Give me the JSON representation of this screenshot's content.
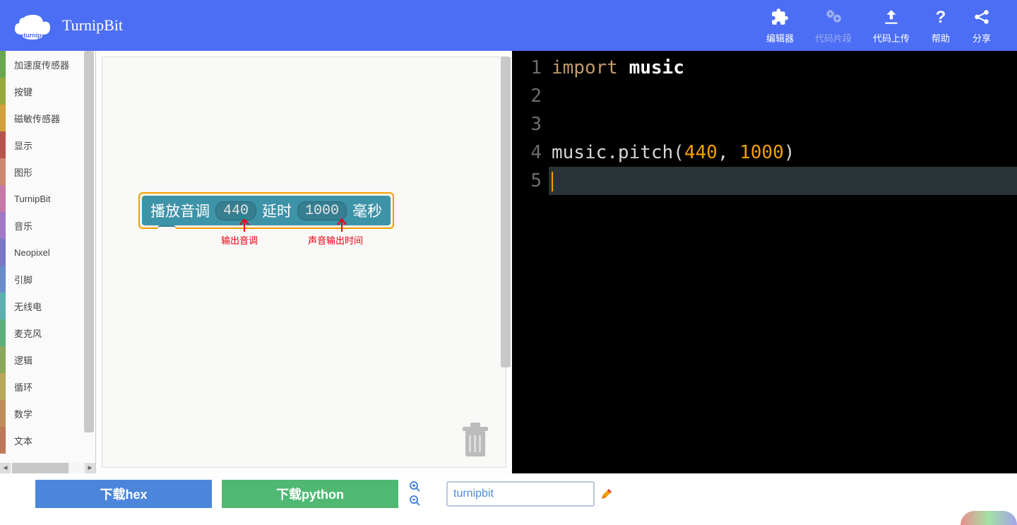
{
  "app_title": "TurnipBit",
  "nav": {
    "editor": "编辑器",
    "snippets": "代码片段",
    "upload": "代码上传",
    "help": "帮助",
    "share": "分享"
  },
  "categories": [
    {
      "label": "加速度传感器",
      "color": "#6aa84f"
    },
    {
      "label": "按键",
      "color": "#99a83c"
    },
    {
      "label": "磁敏传感器",
      "color": "#d4a03b"
    },
    {
      "label": "显示",
      "color": "#b85450"
    },
    {
      "label": "图形",
      "color": "#d08770"
    },
    {
      "label": "TurnipBit",
      "color": "#c678a8"
    },
    {
      "label": "音乐",
      "color": "#a078c6"
    },
    {
      "label": "Neopixel",
      "color": "#7878c6"
    },
    {
      "label": "引脚",
      "color": "#6a8ccc"
    },
    {
      "label": "无线电",
      "color": "#5bb0b0"
    },
    {
      "label": "麦克风",
      "color": "#5bb079"
    },
    {
      "label": "逻辑",
      "color": "#8aa85b"
    },
    {
      "label": "循环",
      "color": "#b8a85b"
    },
    {
      "label": "数学",
      "color": "#c08c5b"
    },
    {
      "label": "文本",
      "color": "#c0785b"
    }
  ],
  "block": {
    "prefix": "播放音调",
    "pitch": "440",
    "mid": "延时",
    "duration": "1000",
    "suffix": "毫秒"
  },
  "annotations": {
    "pitch_label": "输出音调",
    "duration_label": "声音输出时间"
  },
  "code": {
    "lines": [
      {
        "n": "1",
        "tokens": [
          {
            "t": "import ",
            "c": "kw"
          },
          {
            "t": "music",
            "c": "fn"
          }
        ]
      },
      {
        "n": "2",
        "tokens": []
      },
      {
        "n": "3",
        "tokens": []
      },
      {
        "n": "4",
        "tokens": [
          {
            "t": "music.pitch(",
            "c": "id"
          },
          {
            "t": "440",
            "c": "num"
          },
          {
            "t": ", ",
            "c": "id"
          },
          {
            "t": "1000",
            "c": "num"
          },
          {
            "t": ")",
            "c": "id"
          }
        ]
      },
      {
        "n": "5",
        "tokens": [],
        "active": true
      }
    ]
  },
  "footer": {
    "download_hex": "下载hex",
    "download_python": "下载python",
    "project_name": "turnipbit"
  }
}
